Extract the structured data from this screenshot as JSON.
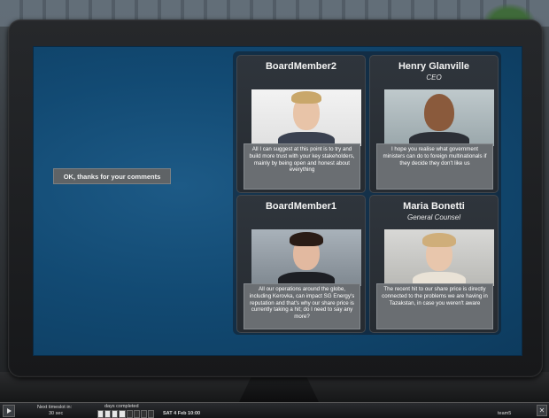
{
  "response_button": {
    "label": "OK, thanks for your comments"
  },
  "cards": [
    {
      "name": "BoardMember2",
      "role": "",
      "speech": "All I can suggest at this point is to try and build more trust with your key stakeholders, mainly by being open and honest about everything",
      "portrait": "blonde-man-portrait"
    },
    {
      "name": "Henry Glanville",
      "role": "CEO",
      "speech": "I hope you realise what government ministers can do to foreign multinationals if they decide they don't like us",
      "portrait": "bald-man-portrait"
    },
    {
      "name": "BoardMember1",
      "role": "",
      "speech": "All our operations around the globe, including Kerovka, can impact SG Energy's reputation and that's why our share price is currently taking a hit; do I need to say any more?",
      "portrait": "dark-haired-woman-portrait"
    },
    {
      "name": "Maria Bonetti",
      "role": "General Counsel",
      "speech": "The recent hit to our share price is directly connected to the problems we are having in Tazakstan, in case you weren't aware",
      "portrait": "blonde-woman-portrait"
    }
  ],
  "hud": {
    "timeslot_label": "Next timeslot in:",
    "timeslot_value": "30 sec",
    "days_label": "days completed",
    "days_progress": {
      "completed": 4,
      "total": 8
    },
    "date": "SAT 4 Feb 10:00",
    "team": "team5",
    "close_symbol": "✕"
  }
}
